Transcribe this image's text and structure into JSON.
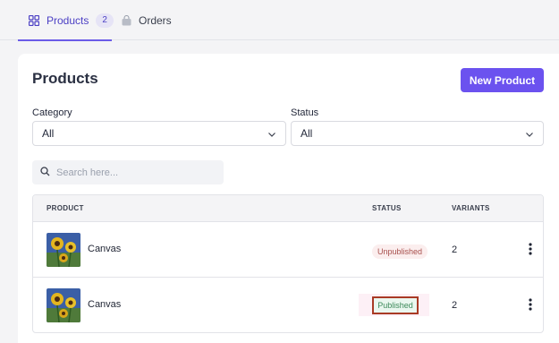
{
  "tabs": {
    "products": {
      "label": "Products",
      "count": "2"
    },
    "orders": {
      "label": "Orders"
    }
  },
  "header": {
    "title": "Products",
    "new_button": "New Product"
  },
  "filters": {
    "category": {
      "label": "Category",
      "value": "All"
    },
    "status": {
      "label": "Status",
      "value": "All"
    }
  },
  "search": {
    "placeholder": "Search here..."
  },
  "table": {
    "columns": [
      "PRODUCT",
      "STATUS",
      "VARIANTS"
    ],
    "rows": [
      {
        "name": "Canvas",
        "status": "Unpublished",
        "variants": "2"
      },
      {
        "name": "Canvas",
        "status": "Published",
        "variants": "2"
      }
    ]
  },
  "colors": {
    "accent": "#6b52ef",
    "unpublished": "#a8504d",
    "published": "#3d8a5a",
    "highlight_border": "#a93a25"
  }
}
